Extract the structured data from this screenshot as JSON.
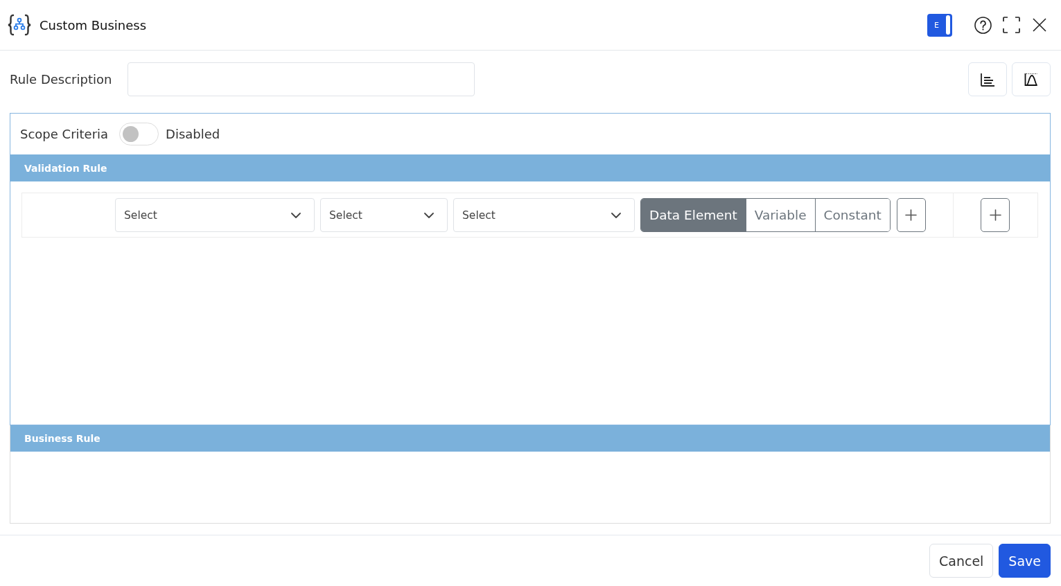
{
  "window": {
    "title": "Custom Business"
  },
  "mode_toggle": {
    "label": "E",
    "on": true
  },
  "rule_description": {
    "label": "Rule Description"
  },
  "scope_criteria": {
    "label": "Scope Criteria",
    "on": false,
    "status": "Disabled"
  },
  "validation_rule": {
    "title": "Validation Rule",
    "condition": {
      "selects": [
        {
          "placeholder": "Select"
        },
        {
          "placeholder": "Select"
        },
        {
          "placeholder": "Select"
        }
      ],
      "operand_types": [
        {
          "label": "Data Element",
          "selected": true
        },
        {
          "label": "Variable",
          "selected": false
        },
        {
          "label": "Constant",
          "selected": false
        }
      ]
    }
  },
  "business_rule": {
    "title": "Business Rule"
  },
  "buttons": [
    {
      "label": "Cancel",
      "kind": "secondary"
    },
    {
      "label": "Save",
      "kind": "primary"
    }
  ]
}
